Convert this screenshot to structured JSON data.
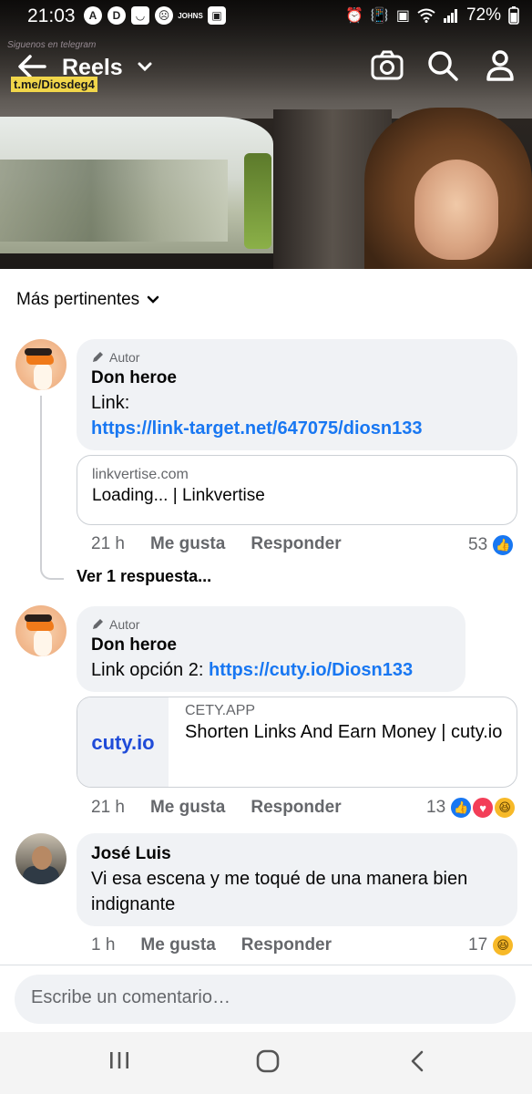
{
  "status_bar": {
    "time": "21:03",
    "app_icons": [
      "A",
      "D",
      "◡",
      "☹",
      "JOHNS",
      "▣"
    ],
    "battery": "72%"
  },
  "header": {
    "title": "Reels",
    "watermark": "t.me/Diosdeg4",
    "watermark_logo": "Siguenos en telegram"
  },
  "sort": {
    "label": "Más pertinentes"
  },
  "comments": [
    {
      "badge": "Autor",
      "author": "Don heroe",
      "lines": [
        "Link:"
      ],
      "link": "https://link-target.net/647075/diosn133",
      "preview": {
        "domain": "linkvertise.com",
        "title": "Loading... | Linkvertise"
      },
      "time": "21 h",
      "like": "Me gusta",
      "reply": "Responder",
      "reaction_count": "53",
      "view_replies": "Ver 1 respuesta..."
    },
    {
      "badge": "Autor",
      "author": "Don heroe",
      "text_prefix": "Link opción 2: ",
      "link": "https://cuty.io/Diosn133",
      "preview": {
        "logo": "cuty.io",
        "domain": "CETY.APP",
        "title": "Shorten Links And Earn Money | cuty.io"
      },
      "time": "21 h",
      "like": "Me gusta",
      "reply": "Responder",
      "reaction_count": "13"
    },
    {
      "author": "José Luis",
      "text": "Vi esa escena y me toqué de una manera bien indignante",
      "time": "1 h",
      "like": "Me gusta",
      "reply": "Responder",
      "reaction_count": "17"
    }
  ],
  "composer": {
    "placeholder": "Escribe un comentario…"
  },
  "colors": {
    "link": "#1877f2",
    "bubble": "#f0f2f5",
    "like": "#1877f2",
    "love": "#f33e58",
    "haha": "#f7b928"
  }
}
